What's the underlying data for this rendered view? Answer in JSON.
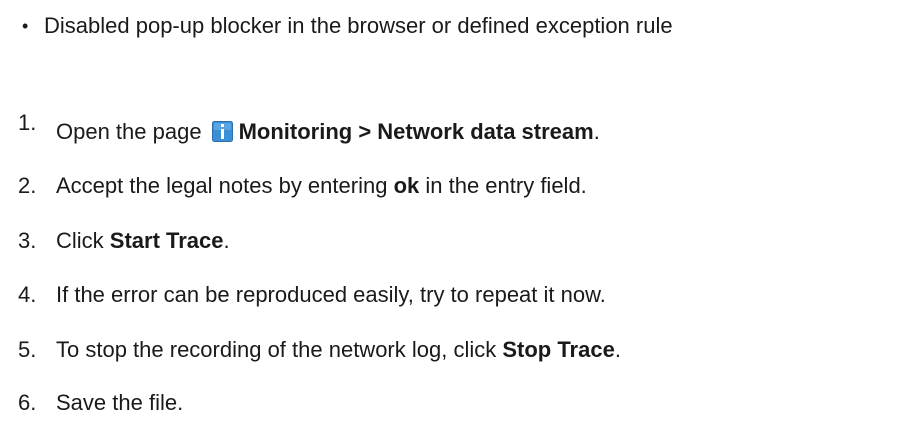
{
  "requirements": {
    "bullet": "Disabled pop-up blocker in the browser or defined exception rule"
  },
  "steps": [
    {
      "number": "1.",
      "pre": "Open the page",
      "icon": "info-icon",
      "bold": "Monitoring > Network data stream",
      "post": "."
    },
    {
      "number": "2.",
      "pre": "Accept the legal notes by entering ",
      "bold": "ok",
      "post": " in the entry field."
    },
    {
      "number": "3.",
      "pre": "Click ",
      "bold": "Start Trace",
      "post": "."
    },
    {
      "number": "4.",
      "pre": "If the error can be reproduced easily, try to repeat it now."
    },
    {
      "number": "5.",
      "pre": "To stop the recording of the network log, click ",
      "bold": "Stop Trace",
      "post": "."
    },
    {
      "number": "6.",
      "pre": "Save the file."
    }
  ],
  "colors": {
    "text": "#1a1a1a",
    "icon_blue": "#3a8fd6"
  }
}
